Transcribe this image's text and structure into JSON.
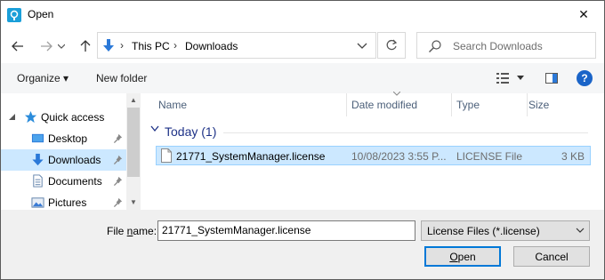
{
  "window": {
    "title": "Open",
    "close_glyph": "✕"
  },
  "address": {
    "crumbs": [
      "This PC",
      "Downloads"
    ],
    "separator": "›"
  },
  "search": {
    "placeholder": "Search Downloads"
  },
  "toolbar": {
    "organize_label": "Organize ▾",
    "new_folder_label": "New folder",
    "help_glyph": "?"
  },
  "sidebar": {
    "quick_access": "Quick access",
    "items": [
      {
        "label": "Desktop",
        "icon": "desktop-folder-icon"
      },
      {
        "label": "Downloads",
        "icon": "downloads-folder-icon",
        "selected": true
      },
      {
        "label": "Documents",
        "icon": "documents-folder-icon"
      },
      {
        "label": "Pictures",
        "icon": "pictures-folder-icon"
      }
    ]
  },
  "columns": {
    "name": "Name",
    "date": "Date modified",
    "type": "Type",
    "size": "Size"
  },
  "groups": [
    {
      "label": "Today (1)",
      "files": [
        {
          "name": "21771_SystemManager.license",
          "date": "10/08/2023 3:55 P...",
          "type": "LICENSE File",
          "size": "3 KB"
        }
      ]
    }
  ],
  "footer": {
    "file_name_label_pre": "File ",
    "file_name_label_ul": "n",
    "file_name_label_post": "ame:",
    "file_name_value": "21771_SystemManager.license",
    "filter_value": "License Files (*.license)",
    "open_ul": "O",
    "open_rest": "pen",
    "cancel_label": "Cancel"
  },
  "colors": {
    "selection": "#cce8ff",
    "accent": "#0078d7",
    "link": "#1e3287"
  }
}
